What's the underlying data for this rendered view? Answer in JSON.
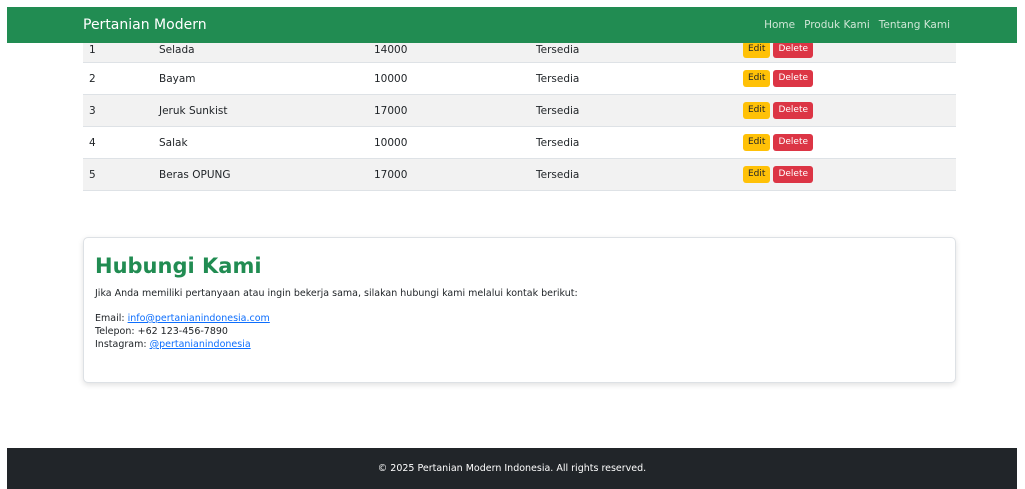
{
  "navbar": {
    "brand": "Pertanian Modern",
    "links": [
      "Home",
      "Produk Kami",
      "Tentang Kami"
    ]
  },
  "products": {
    "rows": [
      {
        "no": "1",
        "name": "Selada",
        "price": "14000",
        "status": "Tersedia"
      },
      {
        "no": "2",
        "name": "Bayam",
        "price": "10000",
        "status": "Tersedia"
      },
      {
        "no": "3",
        "name": "Jeruk Sunkist",
        "price": "17000",
        "status": "Tersedia"
      },
      {
        "no": "4",
        "name": "Salak",
        "price": "10000",
        "status": "Tersedia"
      },
      {
        "no": "5",
        "name": "Beras OPUNG",
        "price": "17000",
        "status": "Tersedia"
      }
    ],
    "edit_label": "Edit",
    "delete_label": "Delete"
  },
  "contact": {
    "title": "Hubungi Kami",
    "intro": "Jika Anda memiliki pertanyaan atau ingin bekerja sama, silakan hubungi kami melalui kontak berikut:",
    "email_label": "Email: ",
    "email": "info@pertanianindonesia.com",
    "phone_label": "Telepon: ",
    "phone": "+62 123-456-7890",
    "instagram_label": "Instagram: ",
    "instagram": "@pertanianindonesia"
  },
  "footer": {
    "text": "© 2025 Pertanian Modern Indonesia. All rights reserved."
  },
  "colors": {
    "brand_green": "#218c52",
    "edit_yellow": "#ffc107",
    "delete_red": "#dc3545",
    "footer_dark": "#212529",
    "link_blue": "#0d6efd"
  }
}
